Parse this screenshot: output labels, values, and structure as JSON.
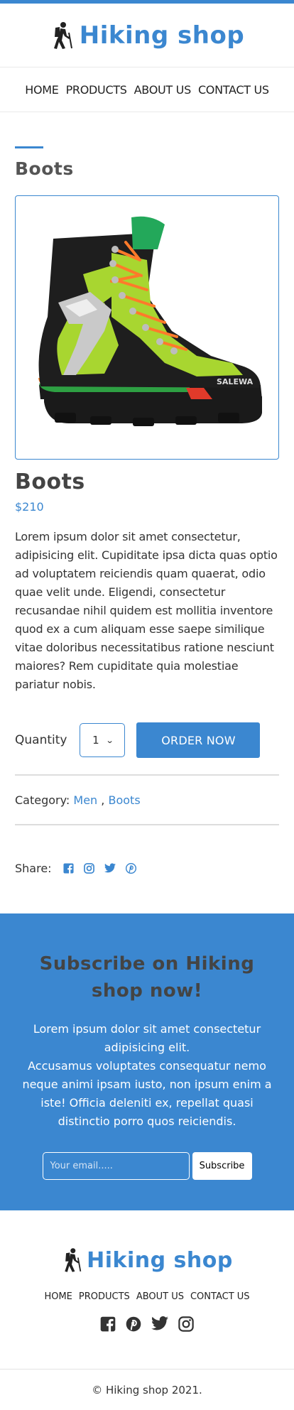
{
  "brand": {
    "name": "Hiking shop",
    "color": "#3b87d0",
    "logo_icon": "hiker-icon"
  },
  "nav": {
    "items": [
      {
        "label": "HOME"
      },
      {
        "label": "PRODUCTS"
      },
      {
        "label": "ABOUT US"
      },
      {
        "label": "CONTACT US"
      }
    ]
  },
  "section": {
    "title": "Boots"
  },
  "product": {
    "image_icon": "boot-image",
    "title": "Boots",
    "price": "$210",
    "description": "Lorem ipsum dolor sit amet consectetur, adipisicing elit. Cupiditate ipsa dicta quas optio ad voluptatem reiciendis quam quaerat, odio quae velit unde. Eligendi, consectetur recusandae nihil quidem est mollitia inventore quod ex a cum aliquam esse saepe similique vitae doloribus necessitatibus ratione nesciunt maiores? Rem cupiditate quia molestiae pariatur nobis.",
    "quantity_label": "Quantity",
    "quantity_value": "1",
    "order_button": "ORDER NOW",
    "category_label": "Category:",
    "categories": [
      "Men",
      "Boots"
    ],
    "category_separator": ",",
    "share_label": "Share:",
    "share_icons": [
      "facebook-icon",
      "instagram-icon",
      "twitter-icon",
      "pinterest-icon"
    ]
  },
  "subscribe": {
    "title": "Subscribe on Hiking shop now!",
    "text_line1": "Lorem ipsum dolor sit amet consectetur adipisicing elit.",
    "text_line2": "Accusamus voluptates consequatur nemo neque animi ipsam iusto, non ipsum enim a iste! Officia deleniti ex, repellat quasi distinctio porro quos reiciendis.",
    "email_placeholder": "Your email.....",
    "button": "Subscribe"
  },
  "footer": {
    "brand": "Hiking shop",
    "nav": [
      {
        "label": "HOME"
      },
      {
        "label": "PRODUCTS"
      },
      {
        "label": "ABOUT US"
      },
      {
        "label": "CONTACT US"
      }
    ],
    "social_icons": [
      "facebook-icon",
      "pinterest-icon",
      "twitter-icon",
      "instagram-icon"
    ],
    "copyright": "© Hiking shop 2021."
  }
}
